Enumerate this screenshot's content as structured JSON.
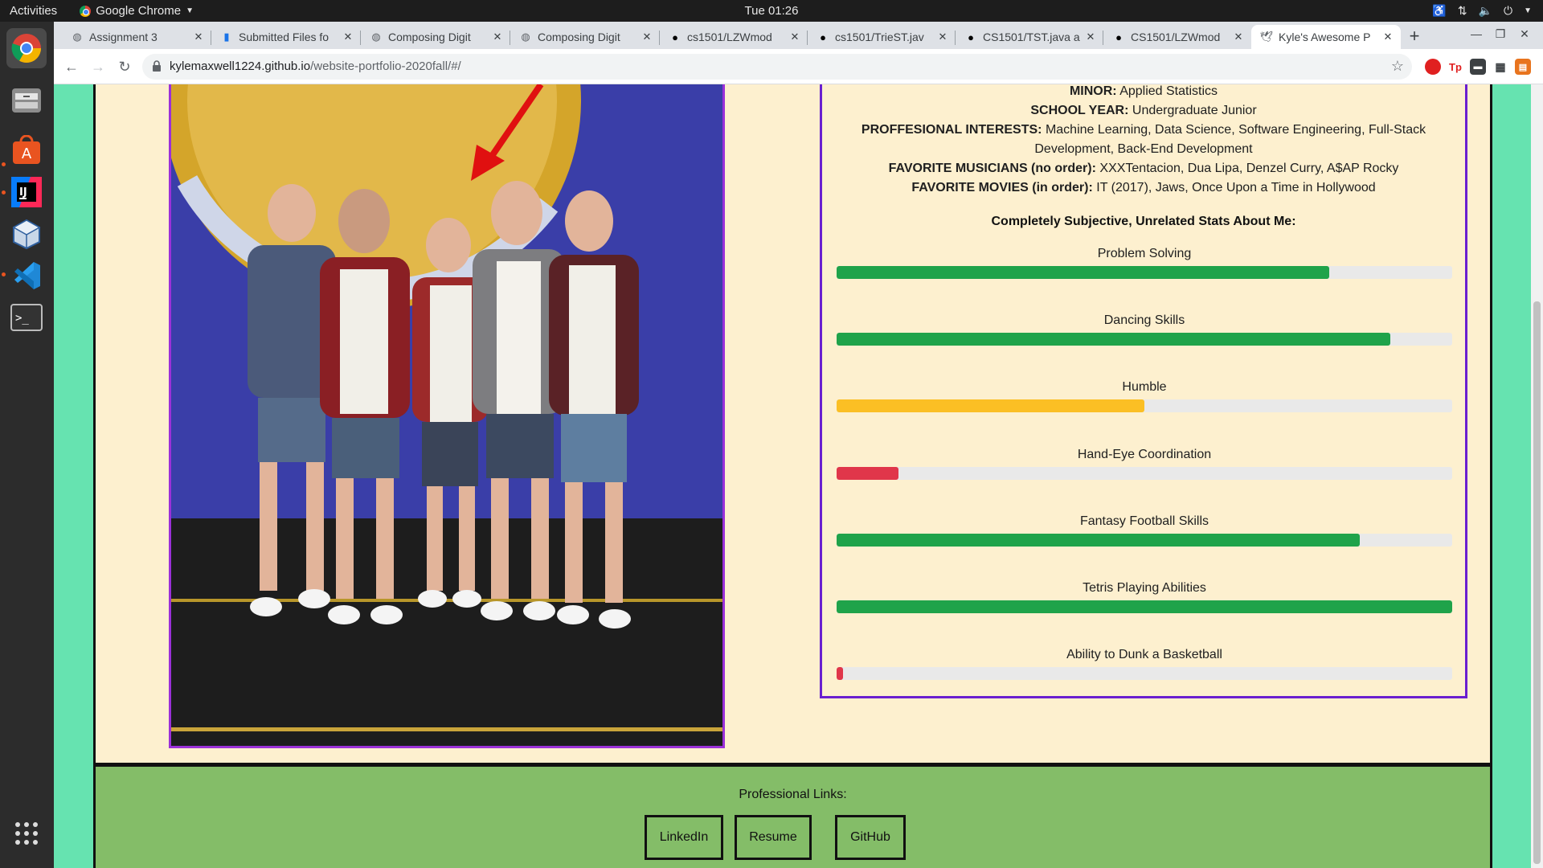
{
  "topbar": {
    "activities": "Activities",
    "app_name": "Google Chrome",
    "clock": "Tue 01:26"
  },
  "browser": {
    "tabs": [
      {
        "title": "Assignment 3",
        "icon": "globe-icon"
      },
      {
        "title": "Submitted Files fo",
        "icon": "chart-icon"
      },
      {
        "title": "Composing Digit",
        "icon": "globe-icon"
      },
      {
        "title": "Composing Digit",
        "icon": "globe-icon"
      },
      {
        "title": "cs1501/LZWmod",
        "icon": "github-icon"
      },
      {
        "title": "cs1501/TrieST.jav",
        "icon": "github-icon"
      },
      {
        "title": "CS1501/TST.java a",
        "icon": "github-icon"
      },
      {
        "title": "CS1501/LZWmod",
        "icon": "github-icon"
      },
      {
        "title": "Kyle's Awesome P",
        "icon": "bird-icon"
      }
    ],
    "active_tab": 8,
    "url_host": "kylemaxwell1224.github.io",
    "url_path": "/website-portfolio-2020fall/#/"
  },
  "about": {
    "lines": [
      {
        "label": "MINOR:",
        "value": "Applied Statistics"
      },
      {
        "label": "SCHOOL YEAR:",
        "value": "Undergraduate Junior"
      },
      {
        "label": "PROFFESIONAL INTERESTS:",
        "value": "Machine Learning, Data Science, Software Engineering, Full-Stack"
      },
      {
        "label": "",
        "value": "Development, Back-End Development"
      },
      {
        "label": "FAVORITE MUSICIANS (no order):",
        "value": "XXXTentacion, Dua Lipa, Denzel Curry, A$AP Rocky"
      },
      {
        "label": "FAVORITE MOVIES (in order):",
        "value": "IT (2017), Jaws, Once Upon a Time in Hollywood"
      }
    ],
    "stats_heading": "Completely Subjective, Unrelated Stats About Me:",
    "stats": [
      {
        "label": "Problem Solving",
        "value": 0.8,
        "color": "#1fa34a"
      },
      {
        "label": "Dancing Skills",
        "value": 0.9,
        "color": "#1fa34a"
      },
      {
        "label": "Humble",
        "value": 0.5,
        "color": "#fbbf24"
      },
      {
        "label": "Hand-Eye Coordination",
        "value": 0.1,
        "color": "#e0364a"
      },
      {
        "label": "Fantasy Football Skills",
        "value": 0.85,
        "color": "#1fa34a"
      },
      {
        "label": "Tetris Playing Abilities",
        "value": 1.0,
        "color": "#1fa34a"
      },
      {
        "label": "Ability to Dunk a Basketball",
        "value": 0.01,
        "color": "#e0364a"
      }
    ]
  },
  "footer": {
    "title": "Professional Links:",
    "links": [
      "LinkedIn",
      "Resume",
      "GitHub"
    ]
  }
}
